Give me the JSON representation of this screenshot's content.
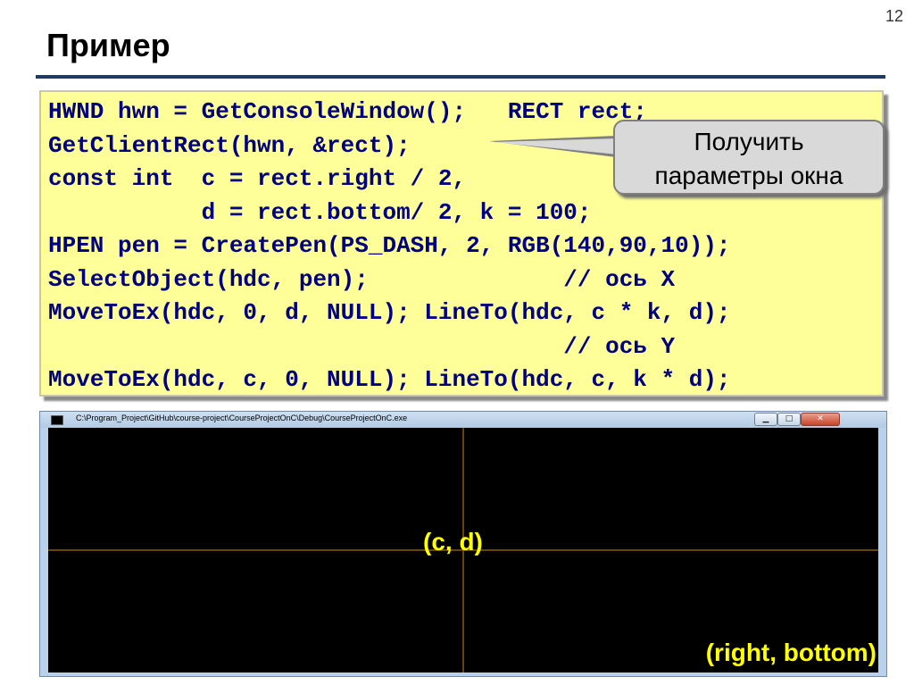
{
  "slide": {
    "page_number": "12",
    "title": "Пример"
  },
  "code": {
    "lines": [
      "HWND hwn = GetConsoleWindow();   RECT rect;",
      "GetClientRect(hwn, &rect);",
      "const int  c = rect.right / 2,",
      "           d = rect.bottom/ 2, k = 100;",
      "HPEN pen = CreatePen(PS_DASH, 2, RGB(140,90,10));",
      "SelectObject(hdc, pen);              // ось X",
      "MoveToEx(hdc, 0, d, NULL); LineTo(hdc, c * k, d);",
      "                                     // ось Y",
      "MoveToEx(hdc, c, 0, NULL); LineTo(hdc, c, k * d);"
    ]
  },
  "callout": {
    "line1": "Получить",
    "line2": "параметры окна"
  },
  "console_window": {
    "title": "C:\\Program_Project\\GitHub\\course-project\\CourseProjectOnC\\Debug\\CourseProjectOnC.exe",
    "minimize_icon": "minimize-icon",
    "maximize_icon": "maximize-icon",
    "close_icon": "close-icon",
    "center_label": "(c, d)",
    "corner_label": "(right, bottom)"
  },
  "colors": {
    "code_background": "#ffff99",
    "code_text": "#000080",
    "axis_line": "#8c5a0a",
    "label_text": "#ffff00",
    "title_rule": "#1f3a63"
  }
}
